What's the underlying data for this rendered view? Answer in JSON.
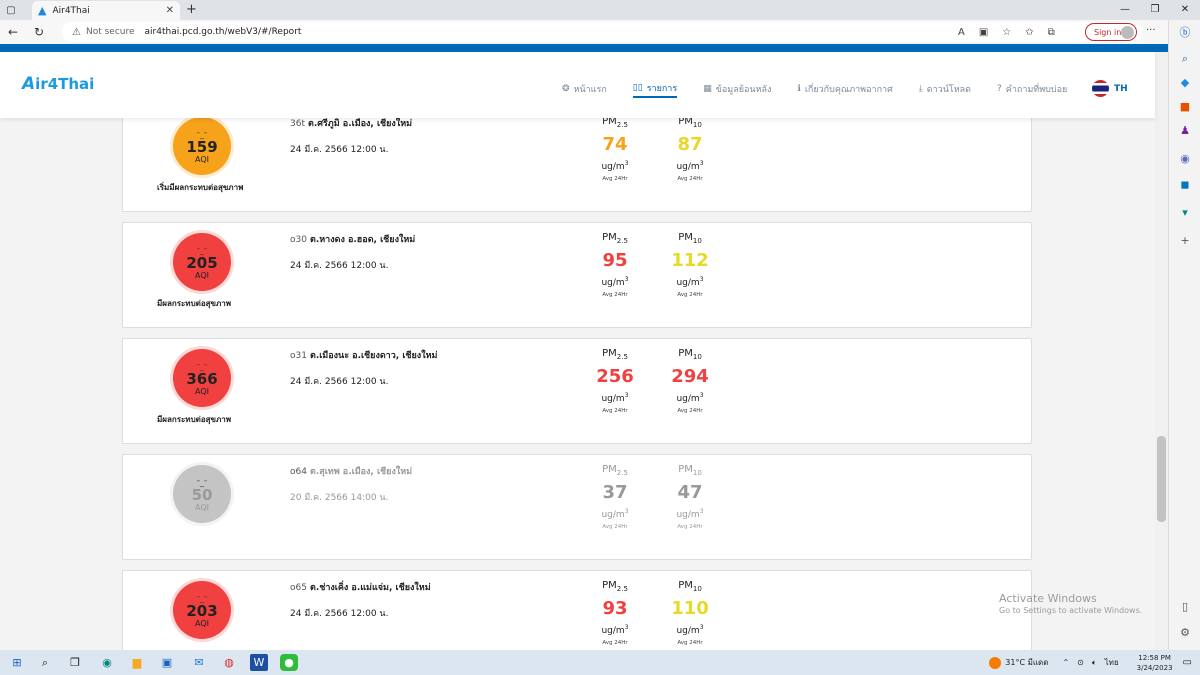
{
  "browser": {
    "tab_title": "Air4Thai",
    "tab_close": "✕",
    "new_tab": "+",
    "security": "Not secure",
    "url": "air4thai.pcd.go.th/webV3/#/Report",
    "signin": "Sign in",
    "window_minimize": "—",
    "window_maximize": "❐",
    "window_close": "✕"
  },
  "site": {
    "logo": "ir4Thai",
    "logo_mark": "A",
    "nav": [
      {
        "label": "หน้าแรก",
        "icon": "dust-icon"
      },
      {
        "label": "รายการ",
        "icon": "list-icon",
        "active": true
      },
      {
        "label": "ข้อมูลย้อนหลัง",
        "icon": "table-icon"
      },
      {
        "label": "เกี่ยวกับคุณภาพอากาศ",
        "icon": "info-icon"
      },
      {
        "label": "ดาวน์โหลด",
        "icon": "download-icon"
      },
      {
        "label": "คำถามที่พบบ่อย",
        "icon": "help-icon"
      }
    ],
    "language": "TH"
  },
  "labels": {
    "pm25": "PM",
    "pm25_sub": "2.5",
    "pm10": "PM",
    "pm10_sub": "10",
    "unit": "ug/m",
    "unit_sup": "3",
    "avg": "Avg 24Hr",
    "aqi": "AQI"
  },
  "stations": [
    {
      "code": "36t",
      "name": "ต.ศรีภูมิ อ.เมือง, เชียงใหม่",
      "datetime": "24 มี.ค. 2566 12:00 น.",
      "aqi": "159",
      "status": "เริ่มมีผลกระทบต่อสุขภาพ",
      "aqi_color": "#f7a21b",
      "pm25": "74",
      "pm25_color": "#f7a21b",
      "pm10": "87",
      "pm10_color": "#e6d92a"
    },
    {
      "code": "o30",
      "name": "ต.หางดง อ.ฮอด, เชียงใหม่",
      "datetime": "24 มี.ค. 2566 12:00 น.",
      "aqi": "205",
      "status": "มีผลกระทบต่อสุขภาพ",
      "aqi_color": "#f04040",
      "pm25": "95",
      "pm25_color": "#f04040",
      "pm10": "112",
      "pm10_color": "#e6d92a"
    },
    {
      "code": "o31",
      "name": "ต.เมืองนะ อ.เชียงดาว, เชียงใหม่",
      "datetime": "24 มี.ค. 2566 12:00 น.",
      "aqi": "366",
      "status": "มีผลกระทบต่อสุขภาพ",
      "aqi_color": "#f04040",
      "pm25": "256",
      "pm25_color": "#f04040",
      "pm10": "294",
      "pm10_color": "#f04040"
    },
    {
      "code": "o64",
      "name": "ต.สุเทพ อ.เมือง, เชียงใหม่",
      "datetime": "20 มี.ค. 2566 14:00 น.",
      "aqi": "50",
      "status": "",
      "aqi_color": "#c4c4c4",
      "pm25": "37",
      "pm25_color": "#999999",
      "pm10": "47",
      "pm10_color": "#999999",
      "inactive": true
    },
    {
      "code": "o65",
      "name": "ต.ช่างเคิ่ง อ.แม่แจ่ม, เชียงใหม่",
      "datetime": "24 มี.ค. 2566 12:00 น.",
      "aqi": "203",
      "status": "",
      "aqi_color": "#f04040",
      "pm25": "93",
      "pm25_color": "#f04040",
      "pm10": "110",
      "pm10_color": "#e6d92a"
    }
  ],
  "watermark": {
    "title": "Activate Windows",
    "subtitle": "Go to Settings to activate Windows."
  },
  "taskbar": {
    "temperature": "31°C",
    "weather": "มีแดด",
    "language": "ไทย",
    "time": "12:58 PM",
    "date": "3/24/2023"
  }
}
